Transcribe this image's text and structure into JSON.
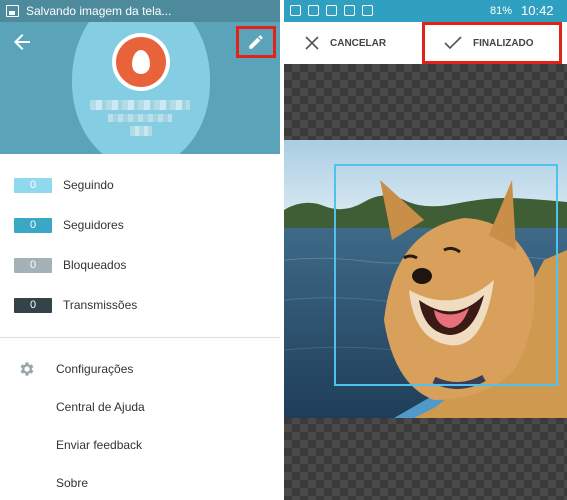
{
  "left_panel": {
    "status_bar": {
      "notification": "Salvando imagem da tela..."
    },
    "stats": [
      {
        "count": "0",
        "label": "Seguindo",
        "color": "#8fd8ee"
      },
      {
        "count": "0",
        "label": "Seguidores",
        "color": "#3aa7c6"
      },
      {
        "count": "0",
        "label": "Bloqueados",
        "color": "#a4b1b6"
      },
      {
        "count": "0",
        "label": "Transmissões",
        "color": "#34424a"
      }
    ],
    "menu": [
      {
        "label": "Configurações",
        "icon": "gear-icon"
      },
      {
        "label": "Central de Ajuda"
      },
      {
        "label": "Enviar feedback"
      },
      {
        "label": "Sobre"
      }
    ]
  },
  "right_panel": {
    "status_bar": {
      "battery": "81%",
      "time": "10:42"
    },
    "toolbar": {
      "cancel_label": "CANCELAR",
      "done_label": "FINALIZADO"
    }
  },
  "colors": {
    "header_bg": "#5ba3b8",
    "status_left": "#4d8a9c",
    "status_right": "#2fa0c0",
    "highlight": "#e2231a",
    "crop_border": "#4ec3ee"
  }
}
